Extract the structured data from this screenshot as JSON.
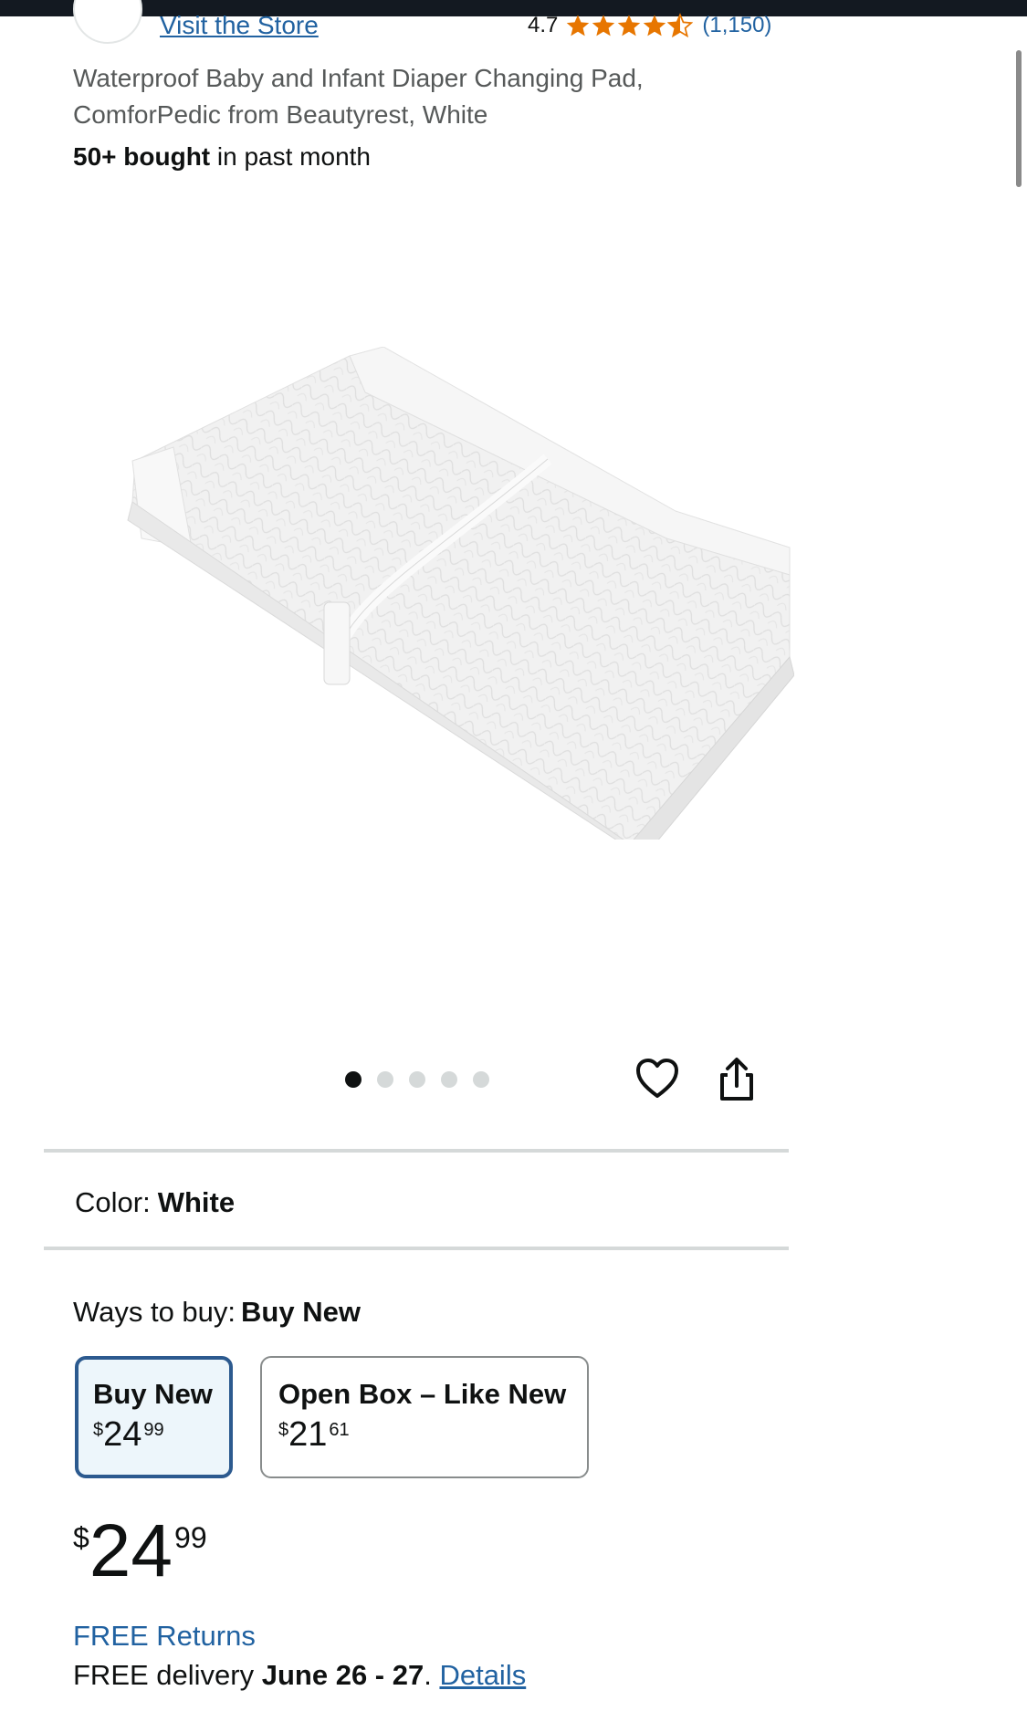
{
  "store": {
    "link_label": "Visit the Store"
  },
  "rating": {
    "value": "4.7",
    "stars": 4.5,
    "count": "(1,150)",
    "star_color": "#e77600"
  },
  "product": {
    "title": "Waterproof Baby and Infant Diaper Changing Pad, ComforPedic from Beautyrest, White",
    "bought_bold": "50+ bought",
    "bought_rest": " in past month"
  },
  "gallery": {
    "image_count": 5,
    "active_index": 0
  },
  "icons": {
    "wishlist": "heart-icon",
    "share": "share-icon"
  },
  "color": {
    "label": "Color:",
    "value": "White"
  },
  "ways_to_buy": {
    "label": "Ways to buy:",
    "selected": "Buy New",
    "options": [
      {
        "label": "Buy New",
        "currency": "$",
        "whole": "24",
        "fraction": "99",
        "selected": true
      },
      {
        "label": "Open Box – Like New",
        "currency": "$",
        "whole": "21",
        "fraction": "61",
        "selected": false
      }
    ]
  },
  "price": {
    "currency": "$",
    "whole": "24",
    "fraction": "99"
  },
  "shipping": {
    "free_returns": "FREE Returns",
    "delivery_prefix": "FREE delivery ",
    "delivery_dates": "June 26 - 27",
    "delivery_suffix": ". ",
    "details_link": "Details"
  },
  "colors": {
    "link": "#2162a1",
    "selected_border": "#2c5a8f",
    "topbar": "#131921"
  }
}
